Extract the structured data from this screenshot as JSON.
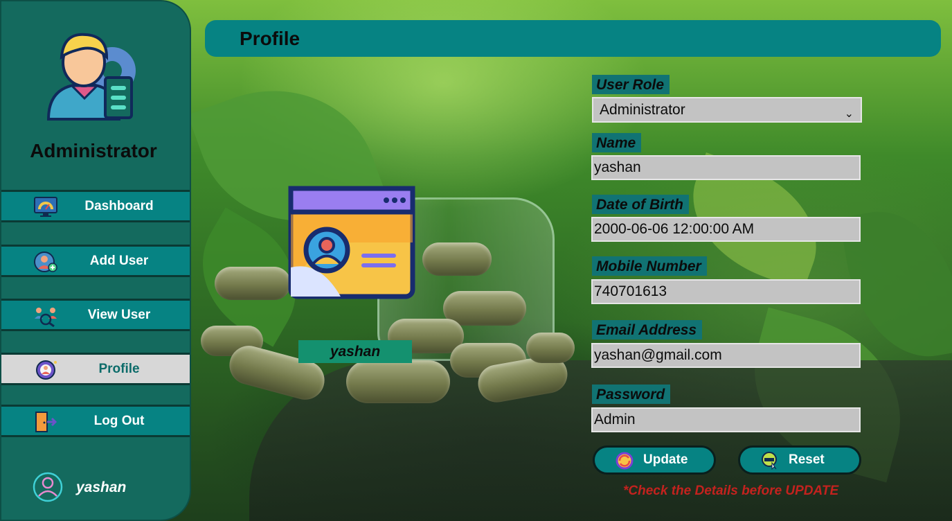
{
  "sidebar": {
    "role_title": "Administrator",
    "items": [
      {
        "label": "Dashboard",
        "icon": "dashboard-icon",
        "active": false
      },
      {
        "label": "Add User",
        "icon": "add-user-icon",
        "active": false
      },
      {
        "label": "View User",
        "icon": "view-user-icon",
        "active": false
      },
      {
        "label": "Profile",
        "icon": "profile-gear-icon",
        "active": true
      },
      {
        "label": "Log Out",
        "icon": "logout-icon",
        "active": false
      }
    ],
    "current_user": "yashan"
  },
  "header": {
    "title": "Profile"
  },
  "profile_card": {
    "name": "yashan",
    "icon": "profile-card-icon"
  },
  "form": {
    "user_role": {
      "label": "User Role",
      "value": "Administrator"
    },
    "name": {
      "label": "Name",
      "value": "yashan"
    },
    "dob": {
      "label": "Date of Birth",
      "value": "2000-06-06 12:00:00 AM"
    },
    "mobile": {
      "label": "Mobile Number",
      "value": "740701613"
    },
    "email": {
      "label": "Email Address",
      "value": "yashan@gmail.com"
    },
    "password": {
      "label": "Password",
      "value": "Admin"
    }
  },
  "buttons": {
    "update": {
      "label": "Update",
      "icon": "update-icon"
    },
    "reset": {
      "label": "Reset",
      "icon": "reset-icon"
    }
  },
  "notice": "*Check the Details before UPDATE",
  "colors": {
    "sidebar_bg": "#146a5e",
    "nav_bg": "#068383",
    "nav_active_bg": "#d7d7d7",
    "field_bg": "#c3c3c3",
    "label_bg": "#117373",
    "warning": "#c4221e"
  }
}
